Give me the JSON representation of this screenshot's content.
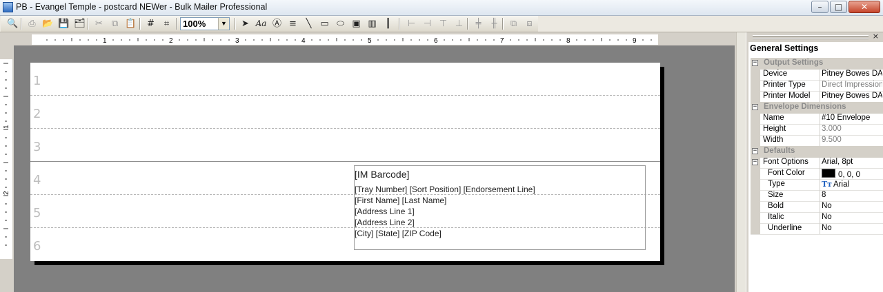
{
  "window": {
    "title": "PB - Evangel Temple - postcard NEWer - Bulk Mailer Professional",
    "controls": {
      "minimize": "–",
      "maximize": "□",
      "close": "✕"
    }
  },
  "toolbar": {
    "zoom": {
      "value": "100%"
    },
    "buttons": [
      {
        "name": "print-preview-icon",
        "glyph": "🔍",
        "enabled": true
      },
      {
        "name": "print-icon",
        "glyph": "⎙",
        "enabled": false
      },
      {
        "name": "open-folder-icon",
        "glyph": "📂",
        "enabled": true
      },
      {
        "name": "save-icon",
        "glyph": "💾",
        "enabled": true
      },
      {
        "name": "save-all-icon",
        "glyph": "🗂",
        "enabled": true
      },
      {
        "name": "cut-icon",
        "glyph": "✂",
        "enabled": false
      },
      {
        "name": "copy-icon",
        "glyph": "⧉",
        "enabled": false
      },
      {
        "name": "paste-icon",
        "glyph": "📋",
        "enabled": false
      },
      {
        "name": "grid-icon",
        "glyph": "#",
        "enabled": true
      },
      {
        "name": "snap-grid-icon",
        "glyph": "⌗",
        "enabled": true
      },
      {
        "name": "pointer-icon",
        "glyph": "➤",
        "enabled": true
      },
      {
        "name": "text-tool-icon",
        "glyph": "Aa",
        "enabled": true
      },
      {
        "name": "field-tool-icon",
        "glyph": "Ⓐ",
        "enabled": true
      },
      {
        "name": "format-text-icon",
        "glyph": "≡",
        "enabled": true
      },
      {
        "name": "line-tool-icon",
        "glyph": "╲",
        "enabled": true
      },
      {
        "name": "rectangle-tool-icon",
        "glyph": "▭",
        "enabled": true
      },
      {
        "name": "ellipse-tool-icon",
        "glyph": "⬭",
        "enabled": true
      },
      {
        "name": "image-tool-icon",
        "glyph": "▣",
        "enabled": true
      },
      {
        "name": "barcode-tool-icon",
        "glyph": "▥",
        "enabled": true
      },
      {
        "name": "imb-barcode-icon",
        "glyph": "┃",
        "enabled": true
      },
      {
        "name": "align-left-icon",
        "glyph": "⊢",
        "enabled": false
      },
      {
        "name": "align-right-icon",
        "glyph": "⊣",
        "enabled": false
      },
      {
        "name": "align-top-icon",
        "glyph": "⊤",
        "enabled": false
      },
      {
        "name": "align-bottom-icon",
        "glyph": "⊥",
        "enabled": false
      },
      {
        "name": "center-vertical-icon",
        "glyph": "╪",
        "enabled": false
      },
      {
        "name": "center-horizontal-icon",
        "glyph": "╫",
        "enabled": false
      },
      {
        "name": "bring-front-icon",
        "glyph": "⧉",
        "enabled": false
      },
      {
        "name": "send-back-icon",
        "glyph": "⧈",
        "enabled": false
      }
    ]
  },
  "ruler": {
    "top_labels": [
      "1",
      "2",
      "3",
      "4",
      "5",
      "6",
      "7",
      "8",
      "9"
    ],
    "left_labels": [
      "1",
      "2"
    ]
  },
  "design": {
    "row_numbers": [
      "1",
      "2",
      "3",
      "4",
      "5",
      "6"
    ],
    "address_block": {
      "lines": [
        "[IM Barcode]",
        "[Tray Number] [Sort Position] [Endorsement Line]",
        "[First Name] [Last Name]",
        "[Address Line 1]",
        "[Address Line 2]",
        "[City] [State] [ZIP Code]"
      ]
    }
  },
  "properties": {
    "title": "General Settings",
    "close": "×",
    "groups": [
      {
        "name": "Output Settings",
        "toggle": "−",
        "rows": [
          {
            "key": "Device",
            "value": "Pitney Bowes DAS",
            "grey": false
          },
          {
            "key": "Printer Type",
            "value": "Direct Impression",
            "grey": true
          },
          {
            "key": "Printer Model",
            "value": "Pitney Bowes DAS",
            "grey": false
          }
        ]
      },
      {
        "name": "Envelope Dimensions",
        "toggle": "−",
        "rows": [
          {
            "key": "Name",
            "value": "#10 Envelope",
            "grey": false
          },
          {
            "key": "Height",
            "value": "3.000",
            "grey": true
          },
          {
            "key": "Width",
            "value": "9.500",
            "grey": true
          }
        ]
      },
      {
        "name": "Defaults",
        "toggle": "−",
        "rows": [
          {
            "key": "Font Options",
            "value": "Arial, 8pt",
            "grey": false,
            "toggle": "−"
          },
          {
            "key": "Font Color",
            "value": "0, 0, 0",
            "grey": false,
            "indent": true,
            "swatch": "#000000"
          },
          {
            "key": "Type",
            "value": "Arial",
            "grey": false,
            "indent": true,
            "icon": "Tт"
          },
          {
            "key": "Size",
            "value": "8",
            "grey": false,
            "indent": true
          },
          {
            "key": "Bold",
            "value": "No",
            "grey": false,
            "indent": true
          },
          {
            "key": "Italic",
            "value": "No",
            "grey": false,
            "indent": true
          },
          {
            "key": "Underline",
            "value": "No",
            "grey": false,
            "indent": true
          }
        ]
      }
    ]
  },
  "colors": {
    "canvas": "#808080",
    "page": "#ffffff",
    "chrome": "#d4d0c8",
    "category_text": "#8a8a8a"
  }
}
